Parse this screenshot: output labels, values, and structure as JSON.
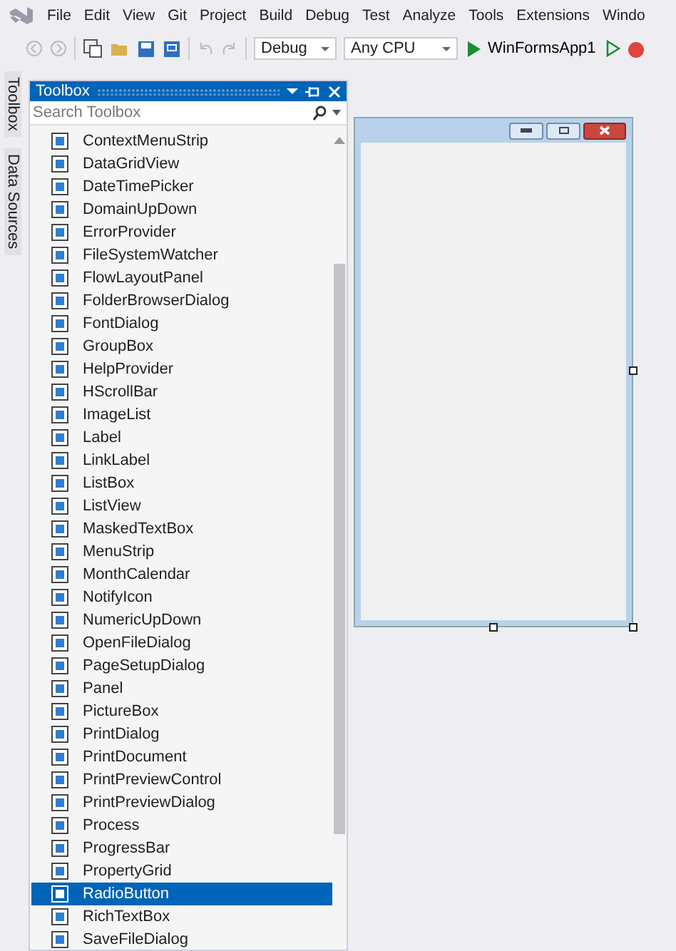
{
  "menu": [
    "File",
    "Edit",
    "View",
    "Git",
    "Project",
    "Build",
    "Debug",
    "Test",
    "Analyze",
    "Tools",
    "Extensions",
    "Windo"
  ],
  "toolbar": {
    "configuration": "Debug",
    "platform": "Any CPU",
    "start_target": "WinFormsApp1"
  },
  "side_tabs": [
    "Toolbox",
    "Data Sources"
  ],
  "toolbox": {
    "title": "Toolbox",
    "search": {
      "placeholder": "Search Toolbox"
    },
    "items": [
      {
        "label": "ContextMenuStrip",
        "selected": false
      },
      {
        "label": "DataGridView",
        "selected": false
      },
      {
        "label": "DateTimePicker",
        "selected": false
      },
      {
        "label": "DomainUpDown",
        "selected": false
      },
      {
        "label": "ErrorProvider",
        "selected": false
      },
      {
        "label": "FileSystemWatcher",
        "selected": false
      },
      {
        "label": "FlowLayoutPanel",
        "selected": false
      },
      {
        "label": "FolderBrowserDialog",
        "selected": false
      },
      {
        "label": "FontDialog",
        "selected": false
      },
      {
        "label": "GroupBox",
        "selected": false
      },
      {
        "label": "HelpProvider",
        "selected": false
      },
      {
        "label": "HScrollBar",
        "selected": false
      },
      {
        "label": "ImageList",
        "selected": false
      },
      {
        "label": "Label",
        "selected": false
      },
      {
        "label": "LinkLabel",
        "selected": false
      },
      {
        "label": "ListBox",
        "selected": false
      },
      {
        "label": "ListView",
        "selected": false
      },
      {
        "label": "MaskedTextBox",
        "selected": false
      },
      {
        "label": "MenuStrip",
        "selected": false
      },
      {
        "label": "MonthCalendar",
        "selected": false
      },
      {
        "label": "NotifyIcon",
        "selected": false
      },
      {
        "label": "NumericUpDown",
        "selected": false
      },
      {
        "label": "OpenFileDialog",
        "selected": false
      },
      {
        "label": "PageSetupDialog",
        "selected": false
      },
      {
        "label": "Panel",
        "selected": false
      },
      {
        "label": "PictureBox",
        "selected": false
      },
      {
        "label": "PrintDialog",
        "selected": false
      },
      {
        "label": "PrintDocument",
        "selected": false
      },
      {
        "label": "PrintPreviewControl",
        "selected": false
      },
      {
        "label": "PrintPreviewDialog",
        "selected": false
      },
      {
        "label": "Process",
        "selected": false
      },
      {
        "label": "ProgressBar",
        "selected": false
      },
      {
        "label": "PropertyGrid",
        "selected": false
      },
      {
        "label": "RadioButton",
        "selected": true
      },
      {
        "label": "RichTextBox",
        "selected": false
      },
      {
        "label": "SaveFileDialog",
        "selected": false
      }
    ]
  }
}
